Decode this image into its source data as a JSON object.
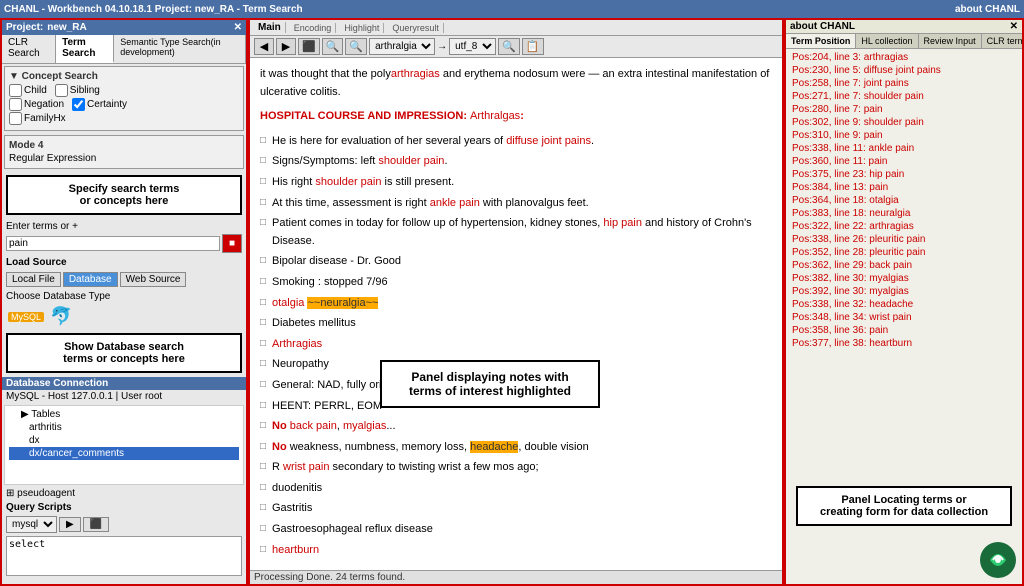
{
  "app": {
    "title": "CHANL - Workbench 04.10.18.1   Project: new_RA - Term Search",
    "about": "about CHANL"
  },
  "project": {
    "label": "Project:",
    "name": "new_RA",
    "title": "Project: new_RA"
  },
  "left_panel": {
    "tabs": [
      {
        "label": "CLR Search",
        "active": false
      },
      {
        "label": "Term Search",
        "active": true
      },
      {
        "label": "Semantic Type Search(in development)",
        "active": false
      }
    ],
    "concept_section": {
      "title": "▼ Concept Search",
      "checkboxes": [
        {
          "label": "Child"
        },
        {
          "label": "Sibling"
        },
        {
          "label": "Negation"
        },
        {
          "label": "Certainty"
        },
        {
          "label": "FamilyHx"
        }
      ]
    },
    "mode_section": {
      "title": "Mode 4",
      "sub": "Regular Expression"
    },
    "callout": {
      "line1": "Specify search terms",
      "line2": "or concepts here"
    },
    "enter_terms_label": "Enter terms or +",
    "search_value": "pain",
    "load_source_label": "Load Source",
    "sources": [
      {
        "label": "Local File"
      },
      {
        "label": "Database",
        "active": true
      },
      {
        "label": "Web Source"
      }
    ],
    "db_type_label": "Choose Database Type",
    "db_callout": {
      "line1": "Show Database search",
      "line2": "terms or concepts here"
    },
    "db_connection": {
      "header": "Database Connection",
      "host": "MySQL - Host 127.0.0.1 | User root",
      "tree": [
        {
          "label": "▶ Tables",
          "indent": 1
        },
        {
          "label": "arthritis",
          "indent": 2
        },
        {
          "label": "dx",
          "indent": 2
        },
        {
          "label": "dx/cancer_comments",
          "indent": 2,
          "selected": true
        }
      ]
    },
    "pseudoagent": "pseudoagent",
    "query_scripts": {
      "label": "Query Scripts",
      "engine": "mysql",
      "query": "select"
    }
  },
  "middle_panel": {
    "toolbar": {
      "nav_buttons": [
        "◀",
        "▶",
        "⬛",
        "◀◀",
        "▶▶"
      ],
      "zoom_buttons": [
        "🔍+",
        "🔍-"
      ],
      "search_field": "arthralgia",
      "encoding_label": "Encoding",
      "encoding_value": "utf_8",
      "highlight_label": "Highlight",
      "query_label": "Queryresult"
    },
    "nav_tabs": [
      {
        "label": "Main",
        "active": true
      },
      {
        "label": "Encoding"
      },
      {
        "label": "Highlight"
      },
      {
        "label": "Queryresult"
      }
    ],
    "document": {
      "lines": [
        {
          "text": "it was thought that the polyarthragias and erythema nodosum were — an extra intestinal manifestation of ulcerative colitis.",
          "highlight": []
        },
        {
          "text": "",
          "spacer": true
        },
        {
          "text": "HOSPITAL COURSE AND IMPRESSION: Arthralgas:",
          "header": true,
          "highlight": [
            "Arthralgas"
          ]
        },
        {
          "text": "",
          "spacer": true
        },
        {
          "text": "He is here for evaluation of her several years of diffuse joint pains.",
          "highlight": [
            "diffuse joint pains"
          ]
        },
        {
          "text": "",
          "spacer": true
        },
        {
          "text": "Signs/Symptoms: left shoulder pain.",
          "highlight": [
            "shoulder pain"
          ]
        },
        {
          "text": "",
          "spacer": true
        },
        {
          "text": "His right shoulder pain is still present.",
          "highlight": [
            "shoulder pain"
          ]
        },
        {
          "text": "",
          "spacer": true
        },
        {
          "text": "At this time, assessment is right ankle pain with planovalgus feet.",
          "highlight": [
            "ankle pain"
          ]
        },
        {
          "text": "",
          "spacer": true
        },
        {
          "text": "Patient comes in today for follow up of hypertension, kidney stones, hip pain and history of Crohn's Disease.",
          "highlight": [
            "hip pain"
          ]
        },
        {
          "text": "Bipolar disease - Dr. Good",
          "highlight": []
        },
        {
          "text": "",
          "spacer": true
        },
        {
          "text": "Smoking : stopped 7/96",
          "highlight": []
        },
        {
          "text": "",
          "spacer": true
        },
        {
          "text": "otalgia ~~neuralgia~~",
          "special": true,
          "highlight": [
            "otalgia",
            "neuralgia"
          ]
        },
        {
          "text": "",
          "spacer": true
        },
        {
          "text": "Diabetes mellitus",
          "highlight": []
        },
        {
          "text": "",
          "spacer": true
        },
        {
          "text": "Arthragias",
          "red": true
        },
        {
          "text": "",
          "spacer": true
        },
        {
          "text": "Neuropathy",
          "highlight": []
        },
        {
          "text": "",
          "spacer": true
        },
        {
          "text": "General: NAD, fully oriented, c/o inspiratory pleuritic pain.",
          "highlight": [
            "pleuritic pain"
          ]
        },
        {
          "text": "",
          "spacer": true
        },
        {
          "text": "HEENT: PERRL, EOM",
          "highlight": []
        },
        {
          "text": "",
          "spacer": true
        },
        {
          "text": "No back pain, myalgias...",
          "bold_red": true,
          "highlight": [
            "back pain",
            "myalgias"
          ]
        },
        {
          "text": "",
          "spacer": true
        },
        {
          "text": "No weakness, numbness, memory loss, headache, double vision",
          "bold_red": true
        },
        {
          "text": "",
          "spacer": true
        },
        {
          "text": "R wrist pain secondary to twisting wrist a few mos ago;",
          "highlight": [
            "wrist pain"
          ]
        },
        {
          "text": "",
          "spacer": true
        },
        {
          "text": "duodenitis",
          "highlight": []
        },
        {
          "text": "Gastritis",
          "highlight": []
        },
        {
          "text": "Gastroesophageal reflux disease",
          "highlight": []
        },
        {
          "text": "heartburn",
          "red": true
        }
      ]
    },
    "callout": {
      "line1": "Panel displaying notes with",
      "line2": "terms of interest highlighted"
    },
    "status": "Processing Done. 24 terms found."
  },
  "right_panel": {
    "tabs": [
      {
        "label": "Term Position",
        "active": true
      },
      {
        "label": "HL collection"
      },
      {
        "label": "Review Input"
      },
      {
        "label": "CLR term mapping"
      }
    ],
    "terms": [
      "Pos:204, line 3: arthragias",
      "Pos:230, line 5: diffuse joint pains",
      "Pos:258, line 7: joint pains",
      "Pos:271, line 7: shoulder pain",
      "Pos:280, line 7: pain",
      "Pos:302, line 9: shoulder pain",
      "Pos:310, line 9: pain",
      "Pos:338, line 11: ankle pain",
      "Pos:360, line 11: pain",
      "Pos:375, line 23: hip pain",
      "Pos:384, line 13: pain",
      "Pos:364, line 18: otalgia",
      "Pos:383, line 18: neuralgia",
      "Pos:322, line 22: arthragias",
      "Pos:338, line 26: pleuritic pain",
      "Pos:352, line 28: pleuritic pain",
      "Pos:362, line 29: back pain",
      "Pos:382, line 30: myalgias",
      "Pos:392, line 30: myalgias",
      "Pos:338, line 32: headache",
      "Pos:348, line 34: wrist pain",
      "Pos:358, line 36: pain",
      "Pos:377, line 38: heartburn"
    ],
    "callout": {
      "line1": "Panel Locating terms or",
      "line2": "creating form for data collection"
    }
  }
}
